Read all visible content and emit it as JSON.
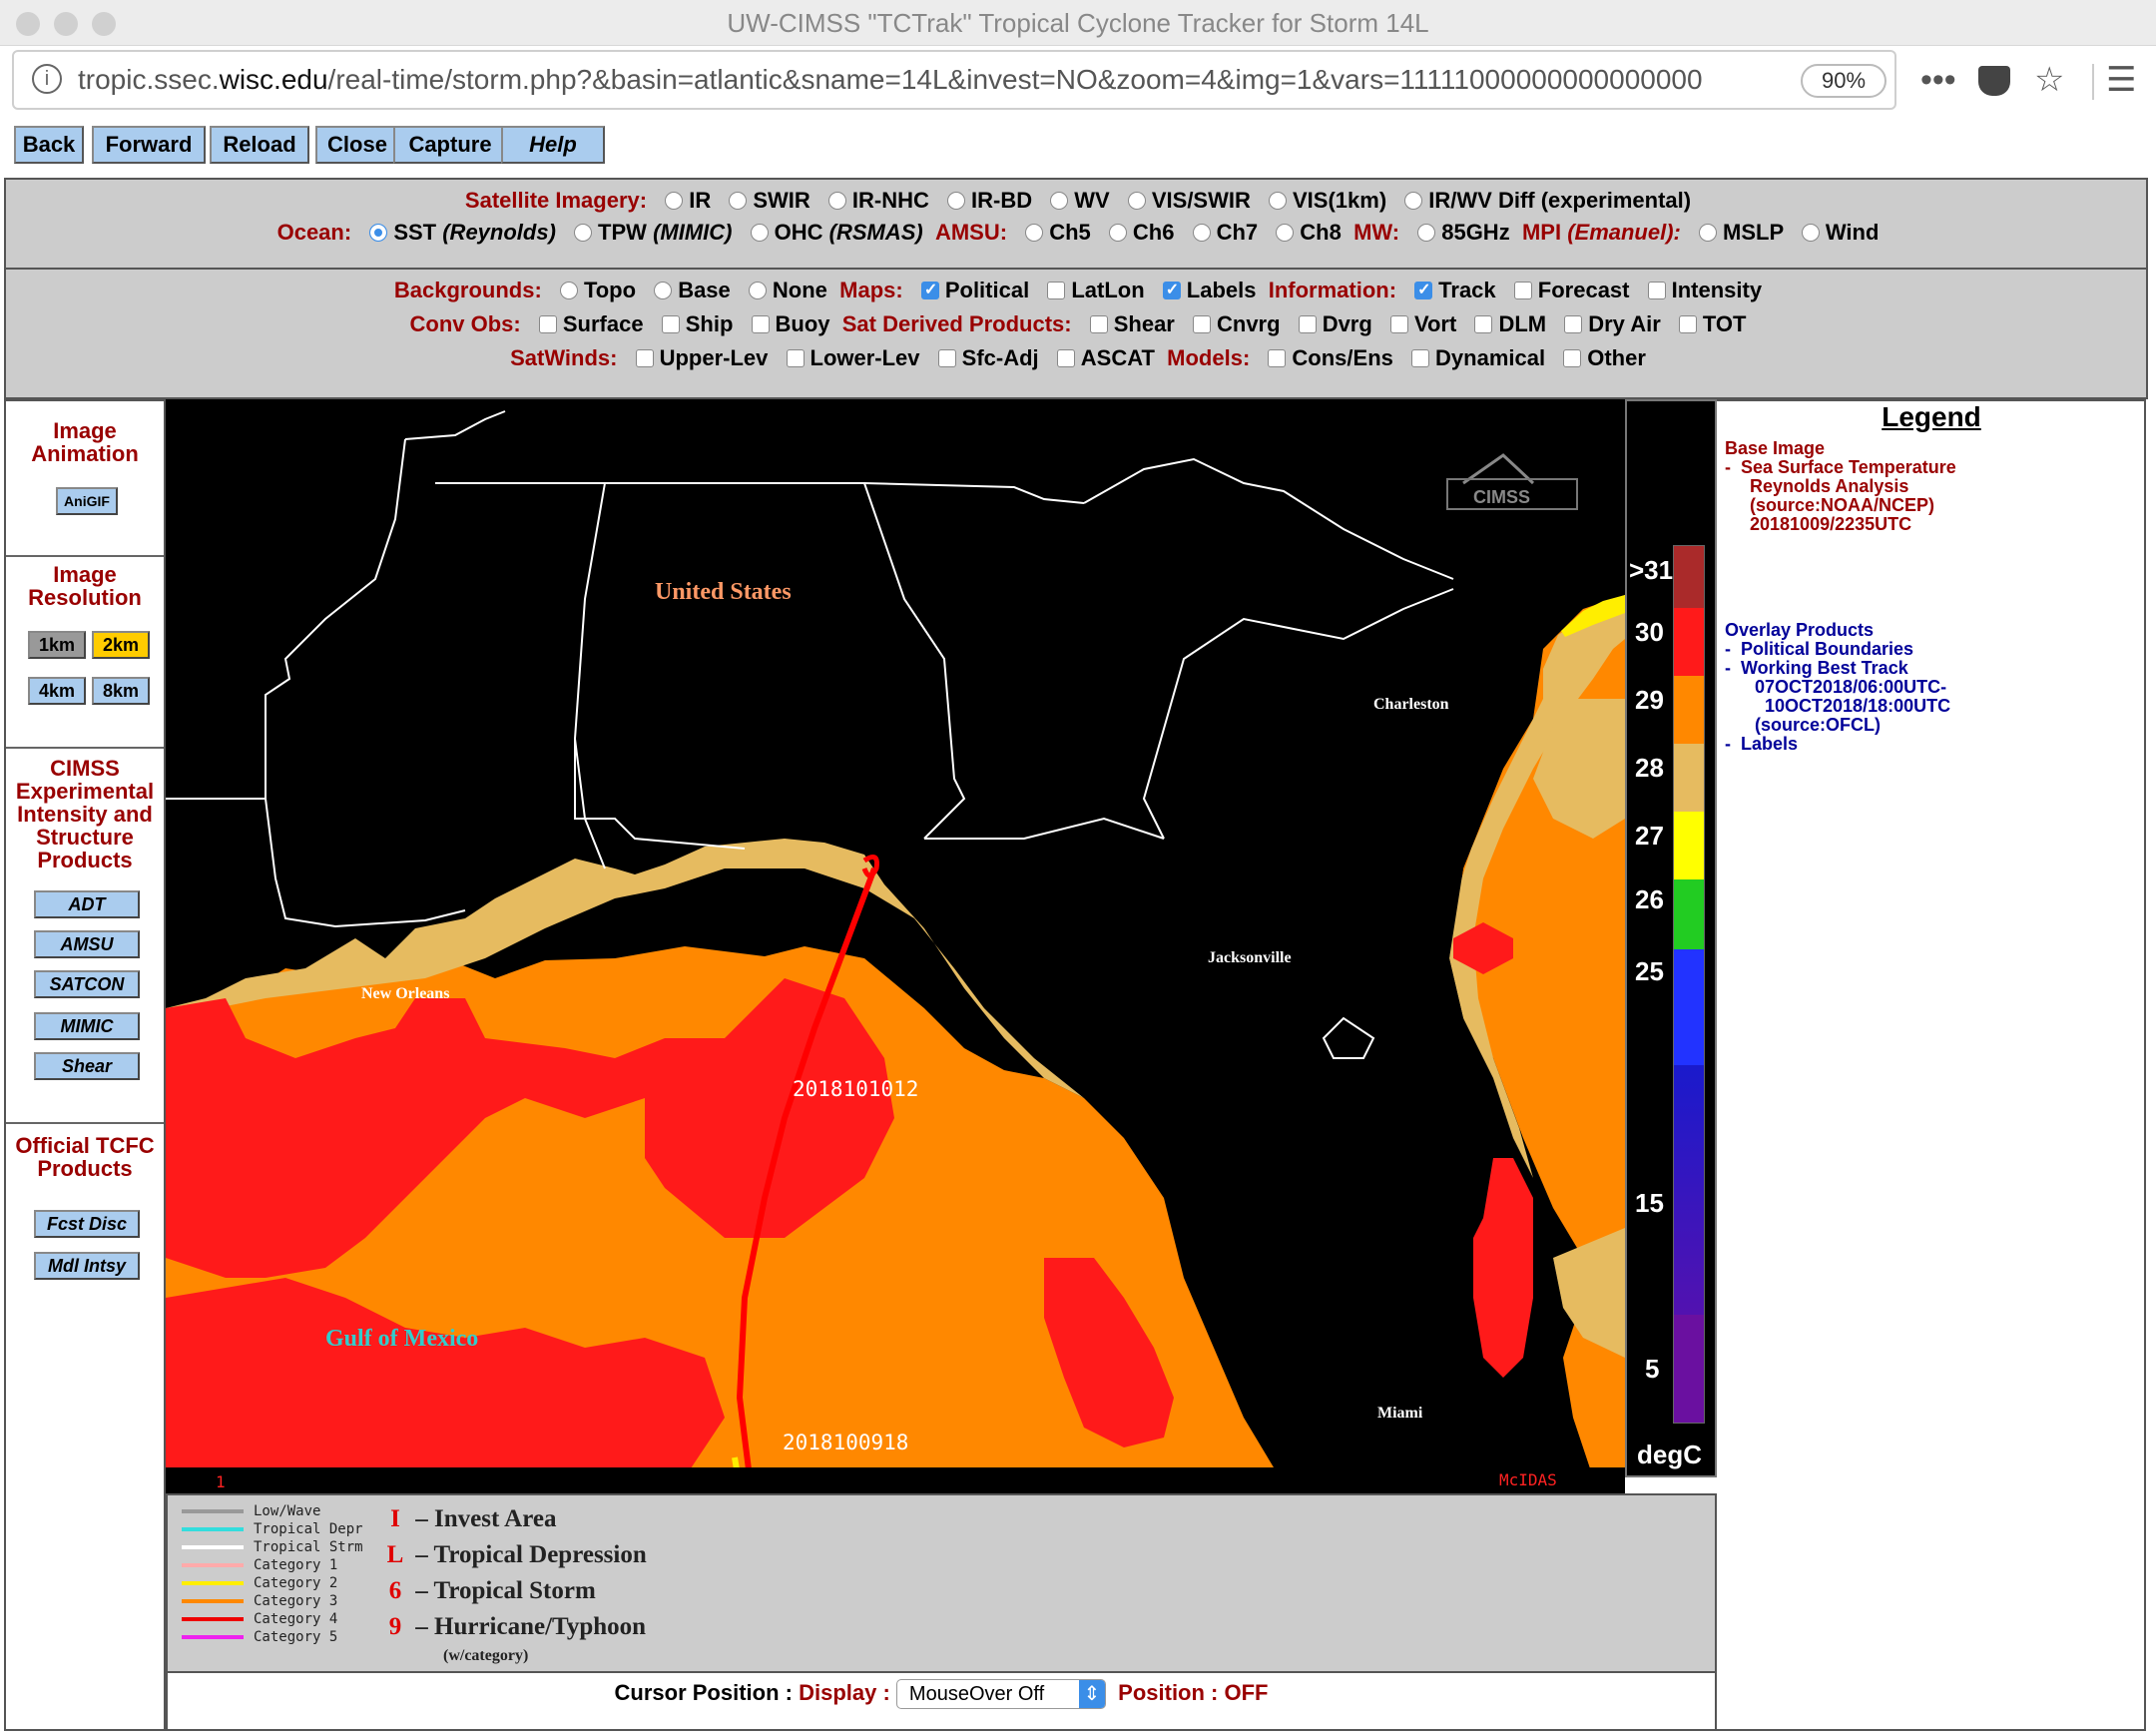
{
  "window": {
    "title": "UW-CIMSS \"TCTrak\" Tropical Cyclone Tracker for Storm 14L"
  },
  "browser": {
    "url_host_pre": "tropic.ssec.",
    "url_host": "wisc.edu",
    "url_path": "/real-time/storm.php?&basin=atlantic&sname=14L&invest=NO&zoom=4&img=1&vars=11111000000000000000",
    "zoom": "90%"
  },
  "nav": [
    "Back",
    "Forward",
    "Reload",
    "Close",
    "Capture",
    "Help"
  ],
  "panel1": {
    "sat_label": "Satellite Imagery:",
    "sat_options": [
      "IR",
      "SWIR",
      "IR-NHC",
      "IR-BD",
      "WV",
      "VIS/SWIR",
      "VIS(1km)",
      "IR/WV Diff (experimental)"
    ],
    "ocean_label": "Ocean:",
    "ocean_options": [
      {
        "name": "SST",
        "src": "(Reynolds)"
      },
      {
        "name": "TPW",
        "src": "(MIMIC)"
      },
      {
        "name": "OHC",
        "src": "(RSMAS)"
      }
    ],
    "amsu_label": "AMSU:",
    "amsu_options": [
      "Ch5",
      "Ch6",
      "Ch7",
      "Ch8"
    ],
    "mw_label": "MW:",
    "mw_options": [
      "85GHz"
    ],
    "mpi_label": "MPI",
    "mpi_src": "(Emanuel):",
    "mpi_options": [
      "MSLP",
      "Wind"
    ]
  },
  "panel2": {
    "backgrounds_label": "Backgrounds:",
    "backgrounds": [
      "Topo",
      "Base",
      "None"
    ],
    "maps_label": "Maps:",
    "maps": [
      "Political",
      "LatLon",
      "Labels"
    ],
    "info_label": "Information:",
    "info": [
      "Track",
      "Forecast",
      "Intensity"
    ],
    "convobs_label": "Conv Obs:",
    "convobs": [
      "Surface",
      "Ship",
      "Buoy"
    ],
    "satderived_label": "Sat Derived Products:",
    "satderived": [
      "Shear",
      "Cnvrg",
      "Dvrg",
      "Vort",
      "DLM",
      "Dry Air",
      "TOT"
    ],
    "satwinds_label": "SatWinds:",
    "satwinds": [
      "Upper-Lev",
      "Lower-Lev",
      "Sfc-Adj",
      "ASCAT"
    ],
    "models_label": "Models:",
    "models": [
      "Cons/Ens",
      "Dynamical",
      "Other"
    ]
  },
  "sidebar": {
    "anim_title": "Image Animation",
    "anigif": "AniGIF",
    "res_title": "Image Resolution",
    "res": [
      "1km",
      "2km",
      "4km",
      "8km"
    ],
    "cimss_title": "CIMSS Experimental Intensity and Structure Products",
    "cimss_buttons": [
      "ADT",
      "AMSU",
      "SATCON",
      "MIMIC",
      "Shear"
    ],
    "tcfc_title": "Official TCFC Products",
    "tcfc_buttons": [
      "Fcst Disc",
      "Mdl Intsy"
    ]
  },
  "map": {
    "labels": {
      "us": "United States",
      "gulf": "Gulf of Mexico",
      "charleston": "Charleston",
      "jacksonville": "Jacksonville",
      "new_orleans": "New Orleans",
      "miami": "Miami",
      "dt1": "2018101012",
      "dt2": "2018100918",
      "frame": "1",
      "mcidas": "McIDAS",
      "logo": "CIMSS"
    }
  },
  "colorbar": {
    "ticks": [
      ">31",
      "30",
      "29",
      "28",
      "27",
      "26",
      "25",
      "15",
      "5"
    ],
    "unit": "degC",
    "colors": [
      "#aa2a2a",
      "#ff1a1a",
      "#ff8800",
      "#e6bb60",
      "#ffff00",
      "#22cc22",
      "#2233ff",
      "#1a1acc",
      "#6a10a0"
    ]
  },
  "legend": {
    "title": "Legend",
    "base_lines": [
      "Base Image",
      "-  Sea Surface Temperature",
      "     Reynolds Analysis",
      "     (source:NOAA/NCEP)",
      "     20181009/2235UTC"
    ],
    "overlay_lines": [
      "Overlay Products",
      "-  Political Boundaries",
      "-  Working Best Track",
      "      07OCT2018/06:00UTC-",
      "        10OCT2018/18:00UTC",
      "      (source:OFCL)",
      "-  Labels"
    ]
  },
  "track_legend": {
    "lines": [
      {
        "label": "Low/Wave",
        "color": "#999999"
      },
      {
        "label": "Tropical Depr",
        "color": "#33dddd"
      },
      {
        "label": "Tropical Strm",
        "color": "#ffffff"
      },
      {
        "label": "Category 1",
        "color": "#ffaaaa"
      },
      {
        "label": "Category 2",
        "color": "#ffee00"
      },
      {
        "label": "Category 3",
        "color": "#ff8800"
      },
      {
        "label": "Category 4",
        "color": "#ee0000"
      },
      {
        "label": "Category 5",
        "color": "#ee22ee"
      }
    ],
    "symbols": [
      {
        "glyph": "I",
        "label": "– Invest Area"
      },
      {
        "glyph": "L",
        "label": "– Tropical Depression"
      },
      {
        "glyph": "6",
        "label": "– Tropical Storm"
      },
      {
        "glyph": "9",
        "label": "– Hurricane/Typhoon"
      }
    ],
    "wcat": "(w/category)"
  },
  "cursor": {
    "label": "Cursor Position :",
    "display_label": "Display :",
    "select_value": "MouseOver Off",
    "position_label": "Position : OFF"
  }
}
